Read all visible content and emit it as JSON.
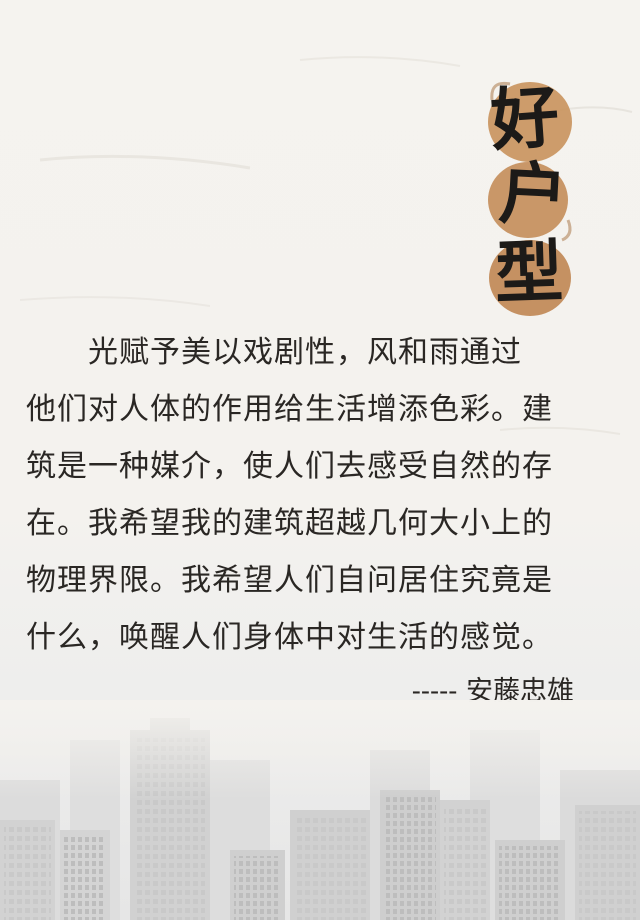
{
  "title": {
    "chars": [
      "好",
      "户",
      "型"
    ],
    "accent_color": "#c38a55"
  },
  "quote": {
    "lines": [
      "光赋予美以戏剧性，风和雨通过",
      "他们对人体的作用给生活增添色彩。建",
      "筑是一种媒介，使人们去感受自然的存",
      "在。我希望我的建筑超越几何大小上的",
      "物理界限。我希望人们自问居住究竟是",
      "什么，唤醒人们身体中对生活的感觉。"
    ]
  },
  "attribution": {
    "dash": "-----",
    "author": "安藤忠雄"
  },
  "colors": {
    "background": "#f4f2ee",
    "text": "#2a2724",
    "skyline": "#cfcfcf"
  }
}
